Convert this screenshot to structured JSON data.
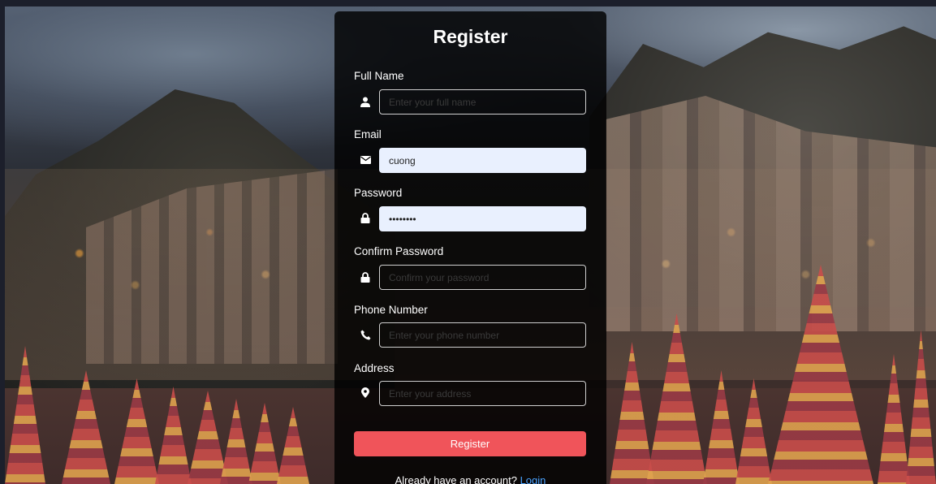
{
  "form": {
    "title": "Register",
    "fields": [
      {
        "label": "Full Name",
        "icon": "user-icon",
        "placeholder": "Enter your full name",
        "value": "",
        "type": "text"
      },
      {
        "label": "Email",
        "icon": "envelope-icon",
        "placeholder": "",
        "value": "cuong",
        "type": "text"
      },
      {
        "label": "Password",
        "icon": "lock-icon",
        "placeholder": "",
        "value": "••••••••",
        "type": "password"
      },
      {
        "label": "Confirm Password",
        "icon": "lock-icon",
        "placeholder": "Confirm your password",
        "value": "",
        "type": "password"
      },
      {
        "label": "Phone Number",
        "icon": "phone-icon",
        "placeholder": "Enter your phone number",
        "value": "",
        "type": "text"
      },
      {
        "label": "Address",
        "icon": "map-pin-icon",
        "placeholder": "Enter your address",
        "value": "",
        "type": "text"
      }
    ],
    "submit_label": "Register",
    "footer_text": "Already have an account?",
    "footer_link": "Login"
  },
  "colors": {
    "card_bg": "#000000",
    "accent": "#f0545a",
    "link": "#4aa3ff",
    "autofill_bg": "#e9f0fe"
  }
}
